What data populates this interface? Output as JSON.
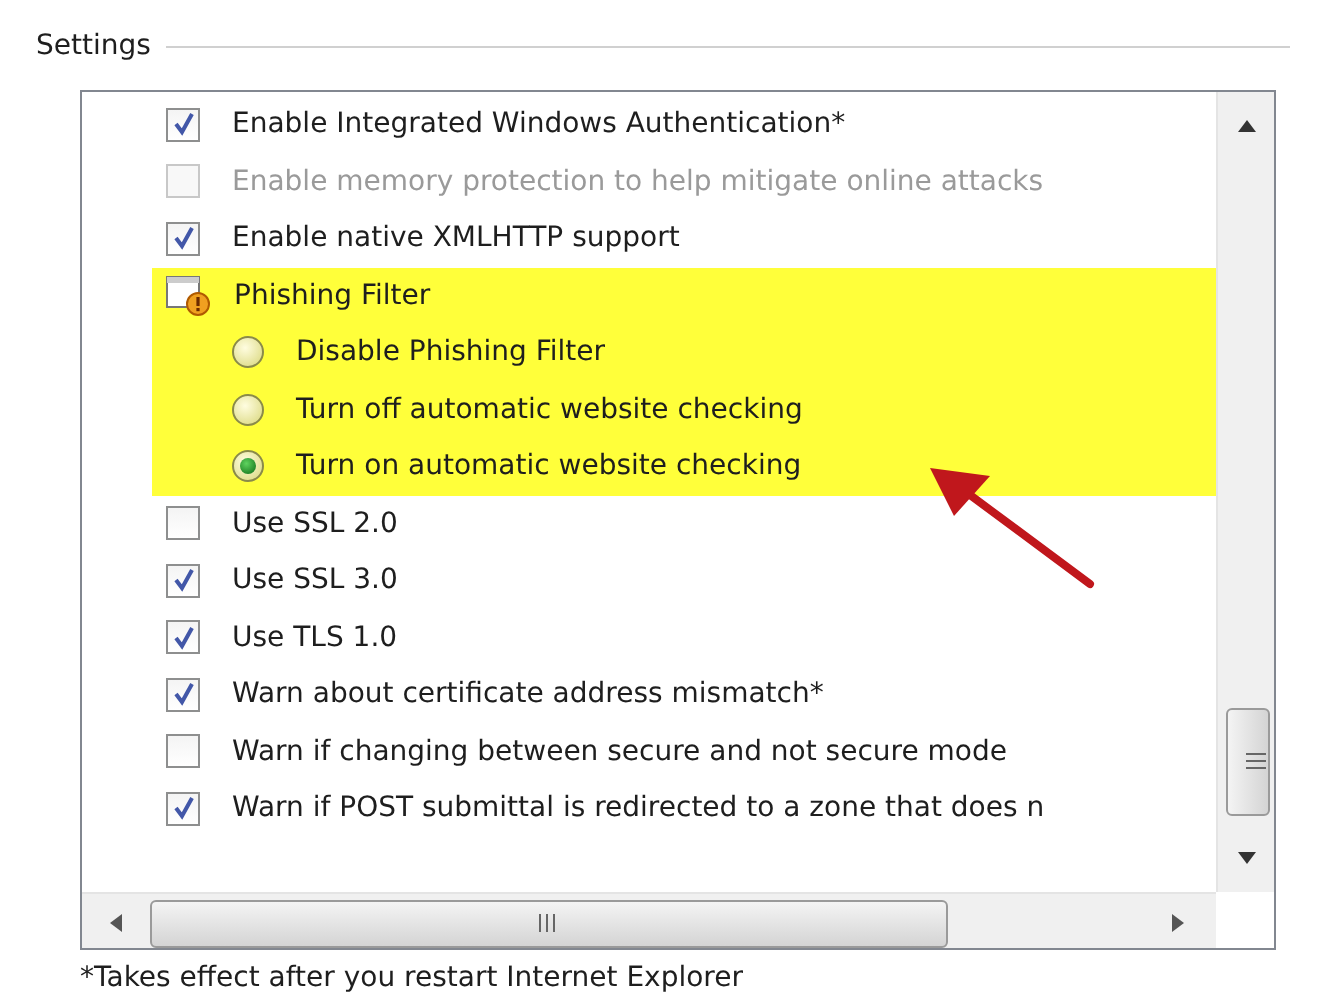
{
  "section_title": "Settings",
  "items": [
    {
      "kind": "checkbox",
      "label": "Enable Integrated Windows Authentication*",
      "checked": true,
      "disabled": false
    },
    {
      "kind": "checkbox",
      "label": "Enable memory protection to help mitigate online attacks",
      "checked": false,
      "disabled": true
    },
    {
      "kind": "checkbox",
      "label": "Enable native XMLHTTP support",
      "checked": true,
      "disabled": false
    },
    {
      "kind": "group",
      "label": "Phishing Filter",
      "highlighted": true,
      "children": [
        {
          "kind": "radio",
          "label": "Disable Phishing Filter",
          "selected": false
        },
        {
          "kind": "radio",
          "label": "Turn off automatic website checking",
          "selected": false
        },
        {
          "kind": "radio",
          "label": "Turn on automatic website checking",
          "selected": true
        }
      ]
    },
    {
      "kind": "checkbox",
      "label": "Use SSL 2.0",
      "checked": false,
      "disabled": false
    },
    {
      "kind": "checkbox",
      "label": "Use SSL 3.0",
      "checked": true,
      "disabled": false
    },
    {
      "kind": "checkbox",
      "label": "Use TLS 1.0",
      "checked": true,
      "disabled": false
    },
    {
      "kind": "checkbox",
      "label": "Warn about certificate address mismatch*",
      "checked": true,
      "disabled": false
    },
    {
      "kind": "checkbox",
      "label": "Warn if changing between secure and not secure mode",
      "checked": false,
      "disabled": false
    },
    {
      "kind": "checkbox",
      "label": "Warn if POST submittal is redirected to a zone that does n",
      "checked": true,
      "disabled": false
    }
  ],
  "footnote": "*Takes effect after you restart Internet Explorer"
}
